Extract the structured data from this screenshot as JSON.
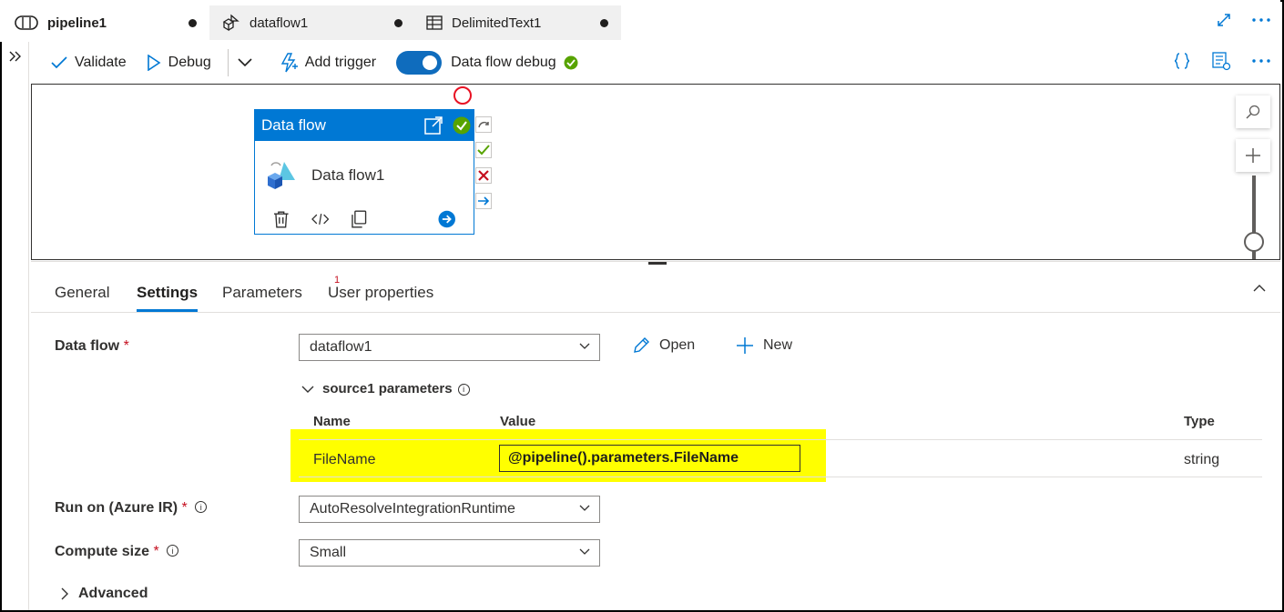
{
  "tabs": [
    {
      "label": "pipeline1",
      "icon": "pipeline-icon",
      "active": true,
      "dirty": true
    },
    {
      "label": "dataflow1",
      "icon": "dataflow-icon",
      "active": false,
      "dirty": true
    },
    {
      "label": "DelimitedText1",
      "icon": "table-icon",
      "active": false,
      "dirty": true
    }
  ],
  "toolbar": {
    "validate": "Validate",
    "debug": "Debug",
    "add_trigger": "Add trigger",
    "dataflow_debug": "Data flow debug",
    "dataflow_debug_on": true
  },
  "canvas": {
    "activity_type": "Data flow",
    "activity_name": "Data flow1"
  },
  "panel": {
    "tabs": [
      "General",
      "Settings",
      "Parameters",
      "User properties"
    ],
    "active_tab": "Settings",
    "parameters_badge": "1",
    "dataflow_label": "Data flow",
    "required_mark": "*",
    "dataflow_value": "dataflow1",
    "open_label": "Open",
    "new_label": "New",
    "source_params_title": "source1 parameters",
    "grid_headers": {
      "name": "Name",
      "value": "Value",
      "type": "Type"
    },
    "grid_row": {
      "name": "FileName",
      "value": "@pipeline().parameters.FileName",
      "type": "string"
    },
    "runon_label": "Run on (Azure IR)",
    "runon_value": "AutoResolveIntegrationRuntime",
    "compute_label": "Compute size",
    "compute_value": "Small",
    "advanced_label": "Advanced"
  },
  "colors": {
    "accent": "#0078d4",
    "success": "#57a300",
    "error": "#c50f1f",
    "highlight": "#ffff00"
  }
}
